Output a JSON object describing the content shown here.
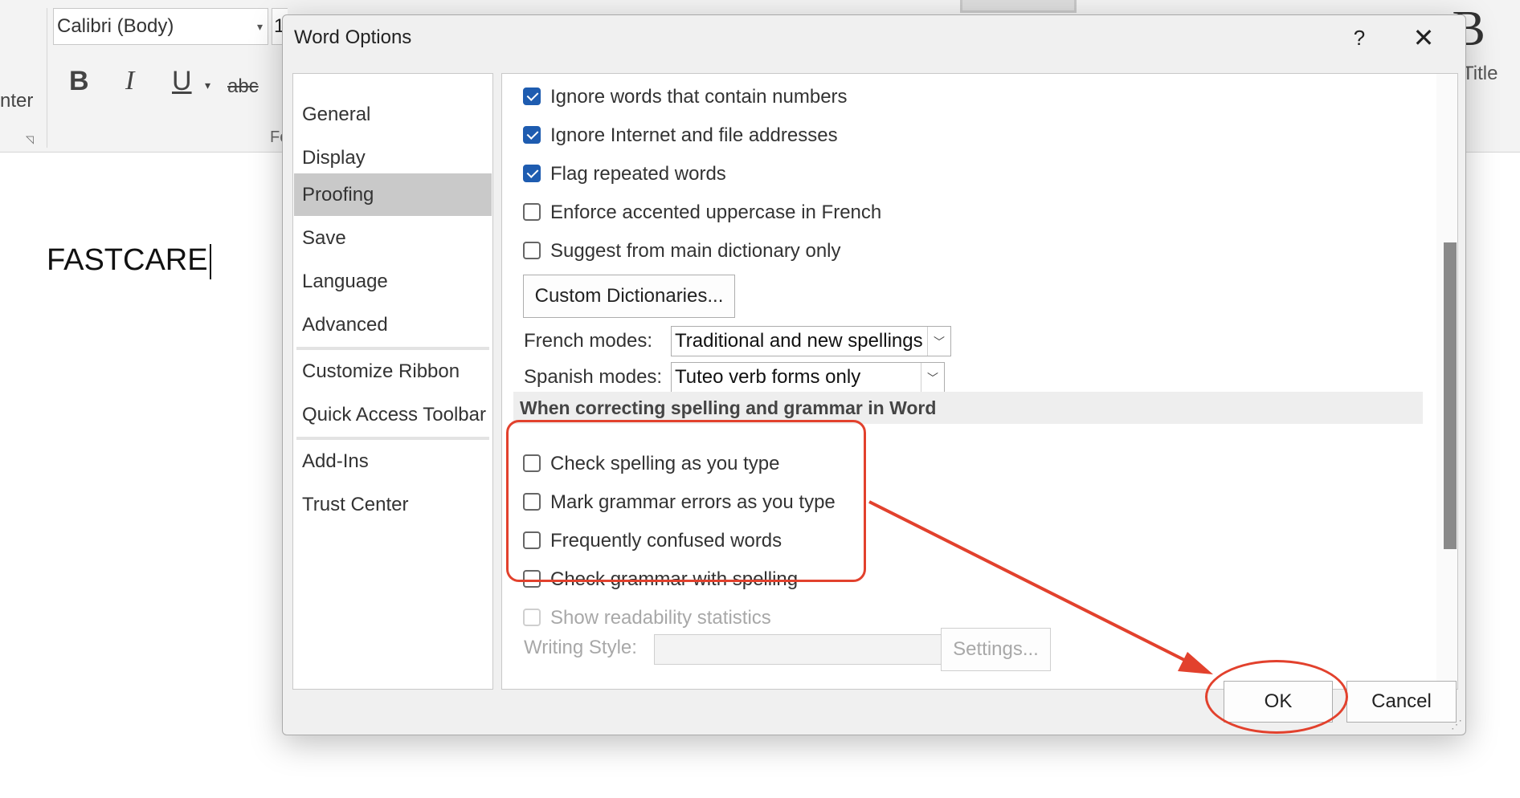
{
  "ribbon": {
    "font_name": "Calibri (Body)",
    "font_size": "1",
    "bold": "B",
    "italic": "I",
    "underline": "U",
    "strikethrough": "abc",
    "left_label": "nter",
    "font_group_label": "Fo",
    "style_preview": "aB",
    "style_title": "Title"
  },
  "document": {
    "text": "FASTCARE"
  },
  "dialog": {
    "title": "Word Options",
    "help": "?",
    "close": "✕",
    "nav": [
      {
        "label": "General"
      },
      {
        "label": "Display"
      },
      {
        "label": "Proofing",
        "selected": true
      },
      {
        "label": "Save"
      },
      {
        "label": "Language"
      },
      {
        "label": "Advanced"
      },
      {
        "label": "Customize Ribbon"
      },
      {
        "label": "Quick Access Toolbar"
      },
      {
        "label": "Add-Ins"
      },
      {
        "label": "Trust Center"
      }
    ],
    "options_top": [
      {
        "label": "Ignore words that contain numbers",
        "checked": true
      },
      {
        "label": "Ignore Internet and file addresses",
        "checked": true
      },
      {
        "label": "Flag repeated words",
        "checked": true
      },
      {
        "label": "Enforce accented uppercase in French",
        "checked": false
      },
      {
        "label": "Suggest from main dictionary only",
        "checked": false
      }
    ],
    "custom_dictionaries": "Custom Dictionaries...",
    "french_modes_label": "French modes:",
    "french_modes_value": "Traditional and new spellings",
    "spanish_modes_label": "Spanish modes:",
    "spanish_modes_value": "Tuteo verb forms only",
    "section_title": "When correcting spelling and grammar in Word",
    "options_grammar": [
      {
        "label": "Check spelling as you type",
        "checked": false
      },
      {
        "label": "Mark grammar errors as you type",
        "checked": false
      },
      {
        "label": "Frequently confused words",
        "checked": false
      },
      {
        "label": "Check grammar with spelling",
        "checked": false
      }
    ],
    "readability": "Show readability statistics",
    "writing_style_label": "Writing Style:",
    "writing_style_value": "",
    "settings_button": "Settings...",
    "ok": "OK",
    "cancel": "Cancel"
  },
  "colors": {
    "annotation": "#e2412d",
    "checkbox_checked": "#1e5cb0",
    "nav_selected": "#c9c9c9"
  }
}
